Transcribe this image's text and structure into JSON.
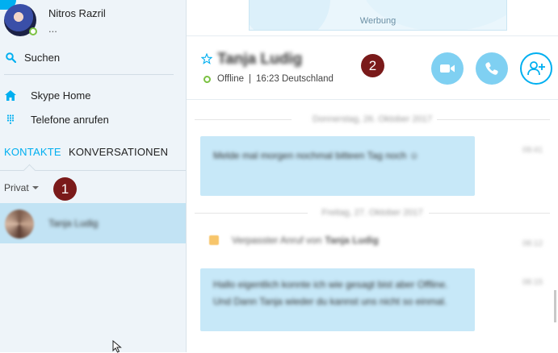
{
  "profile": {
    "name": "Nitros Razril",
    "mood": "..."
  },
  "sidebar": {
    "search_label": "Suchen",
    "nav": [
      {
        "label": "Skype Home",
        "icon": "home-icon"
      },
      {
        "label": "Telefone anrufen",
        "icon": "dialpad-icon"
      }
    ],
    "tabs": {
      "contacts": "KONTAKTE",
      "conversations": "KONVERSATIONEN"
    },
    "filter_label": "Privat",
    "contacts": [
      {
        "name": "Tanja Ludig"
      }
    ]
  },
  "annotations": {
    "marker_1": "1",
    "marker_2": "2"
  },
  "ad": {
    "label": "Werbung"
  },
  "conversation": {
    "name": "Tanja Ludig",
    "status": "Offline",
    "local_time": "16:23 Deutschland",
    "messages": [
      {
        "date": "Donnerstag, 26. Oktober 2017",
        "text": "Melde mal morgen nochmal bitteen Tag noch ☺",
        "time": "09:41"
      },
      {
        "date": "Freitag, 27. Oktober 2017",
        "event_prefix": "Verpasster Anruf von",
        "event_name": "Tanja Ludig",
        "time": "08:12"
      },
      {
        "text": "Hallo eigentlich konnte ich wie gesagt bist aber Offline. Und Dann Tanja wieder du kannst uns nicht so einmal.",
        "time": "08:15"
      }
    ]
  },
  "colors": {
    "accent": "#00aff0",
    "selected_row": "#c2e3f4",
    "bubble": "#c7e8f8",
    "badge": "#7a1a1a",
    "online": "#7cc243"
  }
}
